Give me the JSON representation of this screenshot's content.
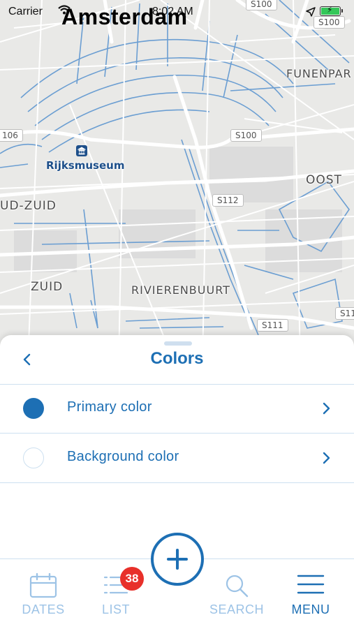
{
  "status_bar": {
    "carrier": "Carrier",
    "time": "8:02 AM",
    "city": "Amsterdam"
  },
  "map": {
    "labels": {
      "rijksmuseum": "Rijksmuseum",
      "oost": "OOST",
      "zuid": "ZUID",
      "oud_zuid": "UD-ZUID",
      "rivierenbuurt": "RIVIERENBUURT",
      "funenpark": "FUNENPAR"
    },
    "shields": {
      "s100_top": "S100",
      "s100_top2": "S100",
      "s100_mid": "S100",
      "s106": "106",
      "s112": "S112",
      "s111": "S111",
      "s11": "S11"
    }
  },
  "sheet": {
    "title": "Colors",
    "rows": [
      {
        "label": "Primary color",
        "swatch_color": "#1d6fb4"
      },
      {
        "label": "Background color",
        "swatch_color": "#ffffff"
      }
    ]
  },
  "tab_bar": {
    "tabs": [
      {
        "label": "DATES",
        "icon": "calendar-icon"
      },
      {
        "label": "LIST",
        "icon": "list-icon",
        "badge": "38"
      },
      {
        "label": "SEARCH",
        "icon": "search-icon"
      },
      {
        "label": "MENU",
        "icon": "menu-icon"
      }
    ],
    "fab_icon": "plus-icon"
  },
  "colors": {
    "accent": "#1d6fb4",
    "inactive": "#9dc3e6",
    "badge": "#e8302a",
    "map_bg": "#e9e9e7",
    "water": "#6b9ed2"
  }
}
